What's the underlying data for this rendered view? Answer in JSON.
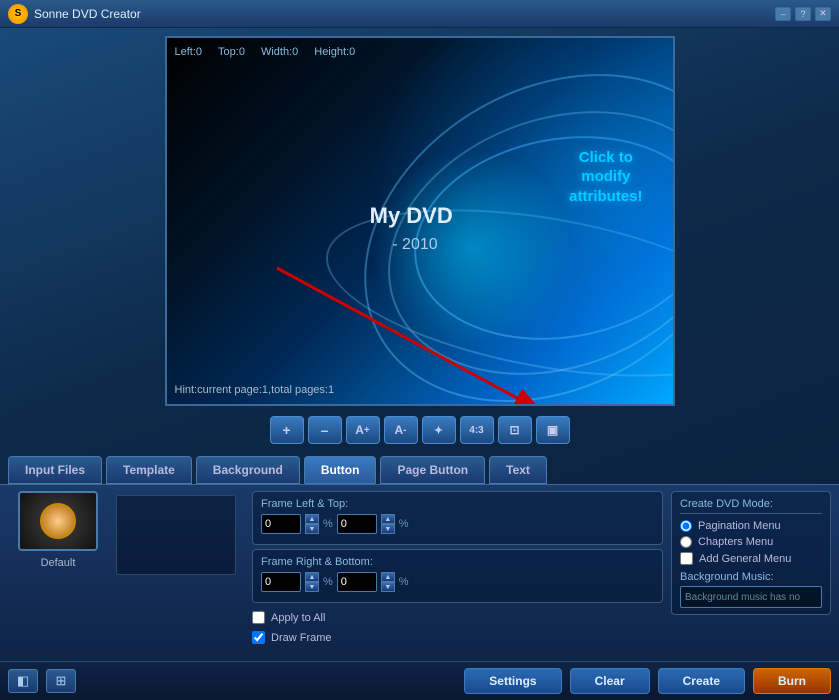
{
  "window": {
    "title": "Sonne DVD Creator",
    "controls": [
      "–",
      "?",
      "✕"
    ]
  },
  "preview": {
    "coords": {
      "left": "Left:0",
      "top": "Top:0",
      "width": "Width:0",
      "height": "Height:0"
    },
    "title": "My DVD",
    "subtitle": "- 2010",
    "click_hint": "Click to\nmodify\nattributes!",
    "hint": "Hint:current page:1,total pages:1"
  },
  "toolbar": {
    "buttons": [
      {
        "id": "add",
        "icon": "+",
        "label": "Add"
      },
      {
        "id": "remove",
        "icon": "–",
        "label": "Remove"
      },
      {
        "id": "text-larger",
        "icon": "A+",
        "label": "Text Larger"
      },
      {
        "id": "text-smaller",
        "icon": "A-",
        "label": "Text Smaller"
      },
      {
        "id": "animate",
        "icon": "✦",
        "label": "Animate"
      },
      {
        "id": "ratio",
        "icon": "4:3",
        "label": "Aspect Ratio"
      },
      {
        "id": "fit",
        "icon": "⊡",
        "label": "Fit"
      },
      {
        "id": "preview2",
        "icon": "▣",
        "label": "Preview"
      }
    ]
  },
  "tabs": [
    {
      "id": "input-files",
      "label": "Input Files",
      "active": false
    },
    {
      "id": "template",
      "label": "Template",
      "active": false
    },
    {
      "id": "background",
      "label": "Background",
      "active": false
    },
    {
      "id": "button",
      "label": "Button",
      "active": true
    },
    {
      "id": "page-button",
      "label": "Page Button",
      "active": false
    },
    {
      "id": "text",
      "label": "Text",
      "active": false
    }
  ],
  "frame": {
    "left_top_label": "Frame Left & Top:",
    "left_value": "0",
    "top_value": "0",
    "right_bottom_label": "Frame Right & Bottom:",
    "right_value": "0",
    "bottom_value": "0",
    "apply_to_all": "Apply to All",
    "draw_frame": "Draw Frame",
    "apply_checked": false,
    "draw_checked": true
  },
  "template": {
    "thumb_label": "Default"
  },
  "dvd_mode": {
    "title": "Create DVD Mode:",
    "options": [
      {
        "id": "pagination",
        "label": "Pagination Menu",
        "selected": true
      },
      {
        "id": "chapters",
        "label": "Chapters Menu",
        "selected": false
      }
    ],
    "add_general_menu": "Add General Menu",
    "add_general_checked": false,
    "background_music_label": "Background Music:",
    "background_music_value": "Background music has no"
  },
  "footer": {
    "settings_label": "Settings",
    "clear_label": "Clear",
    "create_label": "Create",
    "burn_label": "Burn"
  }
}
